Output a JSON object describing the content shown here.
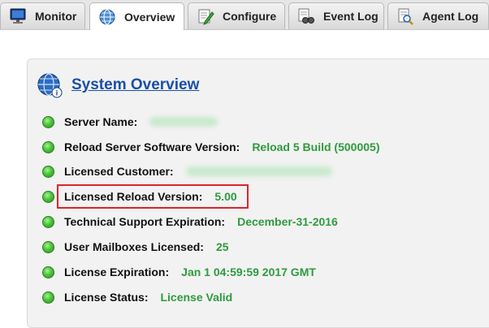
{
  "tabs": [
    {
      "label": "Monitor",
      "icon": "monitor-icon",
      "active": false
    },
    {
      "label": "Overview",
      "icon": "overview-globe-icon",
      "active": true
    },
    {
      "label": "Configure",
      "icon": "configure-pencil-icon",
      "active": false
    },
    {
      "label": "Event Log",
      "icon": "event-log-binoculars-icon",
      "active": false
    },
    {
      "label": "Agent Log",
      "icon": "agent-log-magnifier-icon",
      "active": false
    }
  ],
  "overview": {
    "title": "System Overview",
    "rows": [
      {
        "label": "Server Name:",
        "value": "",
        "blurred": true
      },
      {
        "label": "Reload Server Software Version:",
        "value": "Reload 5 Build (500005)"
      },
      {
        "label": "Licensed Customer:",
        "value": "",
        "blurred": true
      },
      {
        "label": "Licensed Reload Version:",
        "value": "5.00",
        "highlighted": true
      },
      {
        "label": "Technical Support Expiration:",
        "value": "December-31-2016"
      },
      {
        "label": "User Mailboxes Licensed:",
        "value": "25"
      },
      {
        "label": "License Expiration:",
        "value": "Jan 1 04:59:59 2017 GMT"
      },
      {
        "label": "License Status:",
        "value": "License Valid"
      }
    ]
  },
  "colors": {
    "accent": "#1a4fa8",
    "value_green": "#2e9b3e",
    "highlight_border": "#e0232a"
  }
}
